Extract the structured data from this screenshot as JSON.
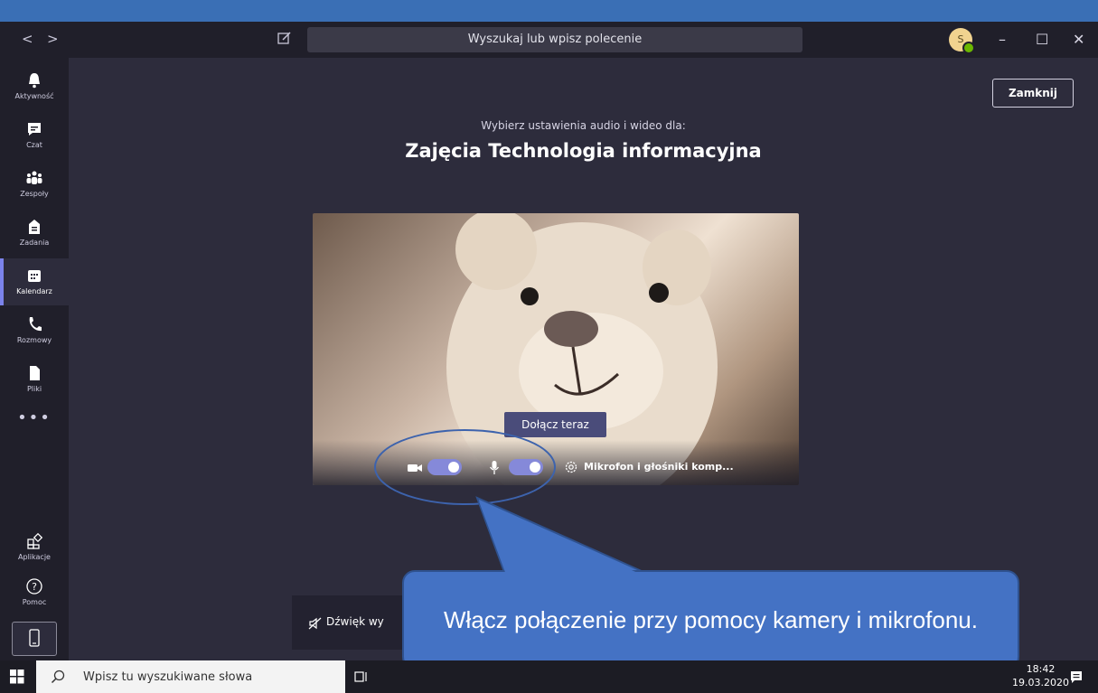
{
  "titlebar": {
    "nav_back": "<",
    "nav_forward": ">",
    "search_placeholder": "Wyszukaj lub wpisz polecenie",
    "avatar_initial": "S",
    "minimize": "–",
    "maximize": "☐",
    "close": "✕"
  },
  "sidebar": {
    "items": [
      {
        "label": "Aktywność",
        "icon": "bell-icon"
      },
      {
        "label": "Czat",
        "icon": "chat-icon"
      },
      {
        "label": "Zespoły",
        "icon": "teams-icon"
      },
      {
        "label": "Zadania",
        "icon": "assignments-icon"
      },
      {
        "label": "Kalendarz",
        "icon": "calendar-icon"
      },
      {
        "label": "Rozmowy",
        "icon": "phone-icon"
      },
      {
        "label": "Pliki",
        "icon": "files-icon"
      }
    ],
    "more": "•••",
    "apps_label": "Aplikacje",
    "help_label": "Pomoc"
  },
  "main": {
    "close_button": "Zamknij",
    "subtitle": "Wybierz ustawienia audio i wideo dla:",
    "meeting_title": "Zajęcia Technologia informacyjna",
    "join_button": "Dołącz teraz",
    "camera_on": true,
    "mic_on": true,
    "device_settings": "Mikrofon i głośniki komp...",
    "sound_off_label": "Dźwięk wy"
  },
  "callout": {
    "text": "Włącz połączenie przy pomocy kamery i mikrofonu."
  },
  "taskbar": {
    "search_placeholder": "Wpisz tu wyszukiwane słowa",
    "time": "18:42",
    "date": "19.03.2020"
  },
  "colors": {
    "app_bg": "#2d2c3c",
    "sidebar_bg": "#201f2a",
    "accent": "#7b83eb",
    "toggle": "#8589d9",
    "callout": "#4472c4"
  }
}
